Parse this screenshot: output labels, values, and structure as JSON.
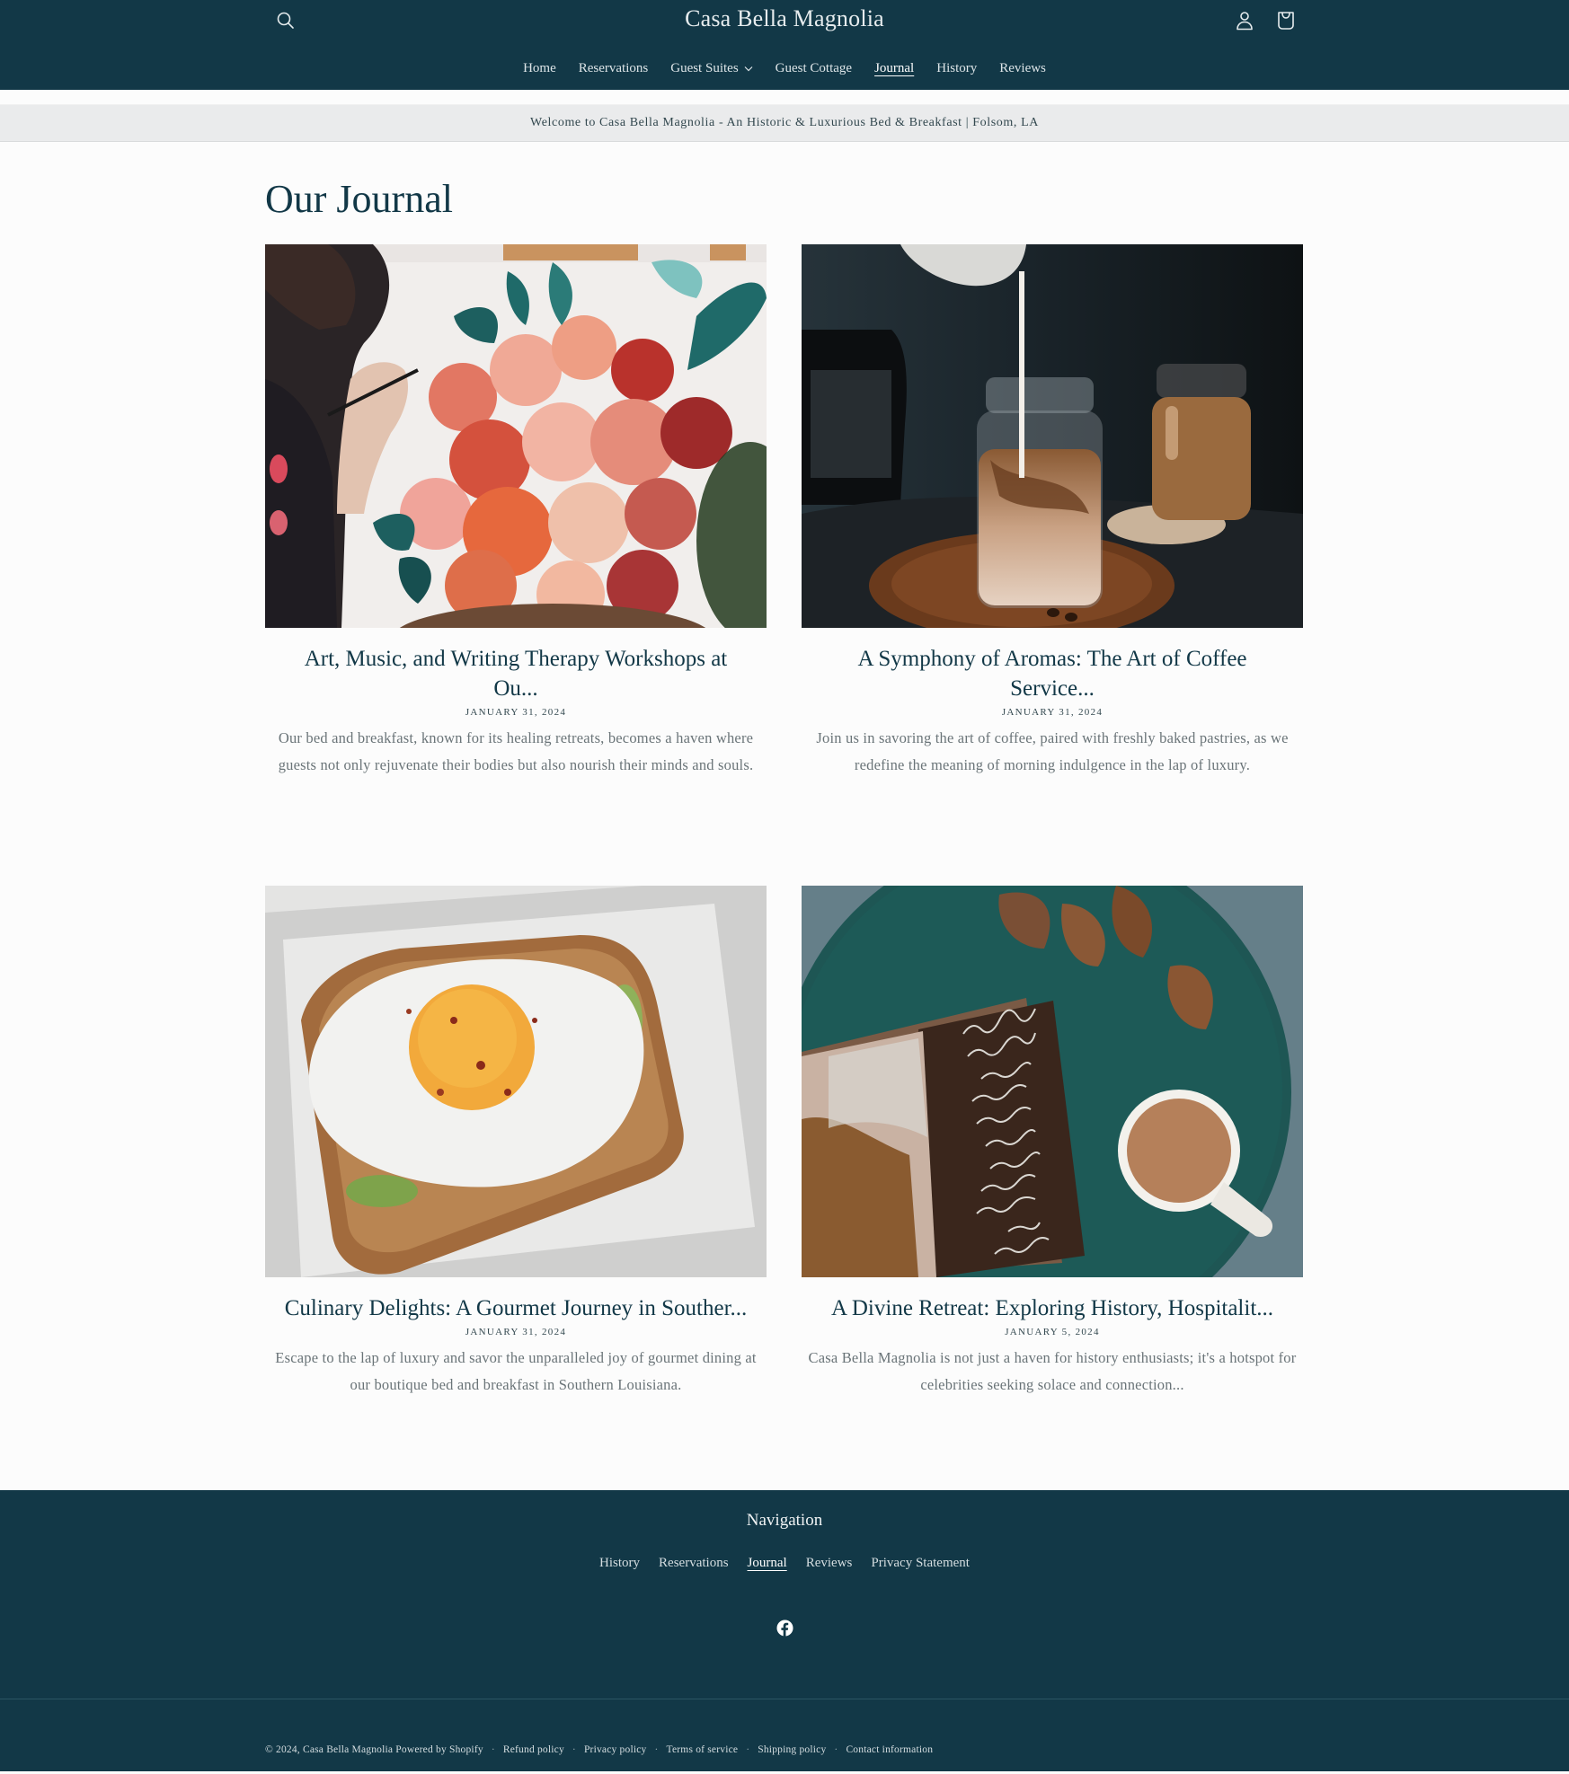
{
  "header": {
    "site_title": "Casa Bella Magnolia",
    "icons": {
      "search": "search-icon",
      "account": "account-icon",
      "cart": "cart-icon"
    },
    "nav": [
      {
        "label": "Home",
        "active": false,
        "has_dropdown": false
      },
      {
        "label": "Reservations",
        "active": false,
        "has_dropdown": false
      },
      {
        "label": "Guest Suites",
        "active": false,
        "has_dropdown": true
      },
      {
        "label": "Guest Cottage",
        "active": false,
        "has_dropdown": false
      },
      {
        "label": "Journal",
        "active": true,
        "has_dropdown": false
      },
      {
        "label": "History",
        "active": false,
        "has_dropdown": false
      },
      {
        "label": "Reviews",
        "active": false,
        "has_dropdown": false
      }
    ]
  },
  "announcement": {
    "text": "Welcome to Casa Bella Magnolia - An Historic & Luxurious Bed & Breakfast | Folsom, LA"
  },
  "main": {
    "page_title": "Our Journal",
    "articles": [
      {
        "title": "Art, Music, and Writing Therapy Workshops at Ou...",
        "date": "JANUARY 31, 2024",
        "excerpt": "Our bed and breakfast, known for its healing retreats, becomes a haven where guests not only rejuvenate their bodies but also nourish their minds and souls.",
        "image": "painting-flowers-image"
      },
      {
        "title": "A Symphony of Aromas: The Art of Coffee Service...",
        "date": "JANUARY 31, 2024",
        "excerpt": "Join us in savoring the art of coffee, paired with freshly baked pastries, as we redefine the meaning of morning indulgence in the lap of luxury.",
        "image": "iced-coffee-jar-image"
      },
      {
        "title": "Culinary Delights: A Gourmet Journey in Souther...",
        "date": "JANUARY 31, 2024",
        "excerpt": "Escape to the lap of luxury and savor the unparalleled joy of gourmet dining at our boutique bed and breakfast in Southern Louisiana.",
        "image": "egg-toast-image"
      },
      {
        "title": "A Divine Retreat: Exploring History, Hospitalit...",
        "date": "JANUARY 5, 2024",
        "excerpt": "Casa Bella Magnolia is not just a haven for history enthusiasts; it's a hotspot for celebrities seeking solace and connection...",
        "image": "bible-coffee-tray-image",
        "image_caption": [
          "Then the LORD",
          "turned to him",
          "and said,",
          "\"Go with",
          "the strength",
          "you have,",
          "and rescue",
          "Israel from",
          "the Midianites.",
          "I am",
          "sending you!\"",
          "JUDGES 6:14"
        ]
      }
    ]
  },
  "footer": {
    "nav_title": "Navigation",
    "nav": [
      {
        "label": "History",
        "active": false
      },
      {
        "label": "Reservations",
        "active": false
      },
      {
        "label": "Journal",
        "active": true
      },
      {
        "label": "Reviews",
        "active": false
      },
      {
        "label": "Privacy Statement",
        "active": false
      }
    ],
    "social": [
      {
        "icon": "facebook-icon"
      }
    ],
    "copyright": "© 2024, Casa Bella Magnolia",
    "powered_by": "Powered by Shopify",
    "policies": [
      "Refund policy",
      "Privacy policy",
      "Terms of service",
      "Shipping policy",
      "Contact information"
    ]
  },
  "colors": {
    "brand_dark": "#123847",
    "announcement_bg": "#eaebec",
    "page_bg": "#fcfcfc",
    "excerpt_text": "#6a7478"
  }
}
